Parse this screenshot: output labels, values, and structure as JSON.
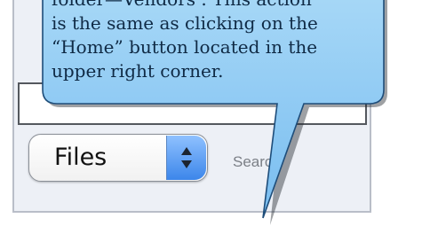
{
  "search_panel": {
    "scope_select": {
      "selected": "Files"
    },
    "search_label": "Search"
  },
  "callout": {
    "lines": [
      "folder—Vendors . This action",
      "is the same as clicking on the",
      "“Home” button located in the",
      "upper right corner."
    ]
  },
  "icons": [
    "stepper-arrows-icon"
  ],
  "colors": {
    "callout_fill": "#8cc9f2",
    "callout_border": "#1e4d7a",
    "stepper_blue": "#4b93f0"
  }
}
